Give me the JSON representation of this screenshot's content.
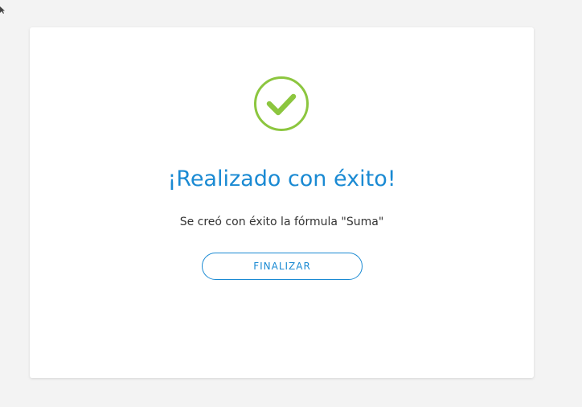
{
  "dialog": {
    "icon": "check-circle-icon",
    "title": "¡Realizado con éxito!",
    "message": "Se creó con éxito la fórmula \"Suma\"",
    "button_label": "FINALIZAR"
  },
  "colors": {
    "accent": "#1a8ad3",
    "success": "#8cc63f",
    "background": "#f3f3f3",
    "card": "#ffffff",
    "text": "#333333"
  }
}
